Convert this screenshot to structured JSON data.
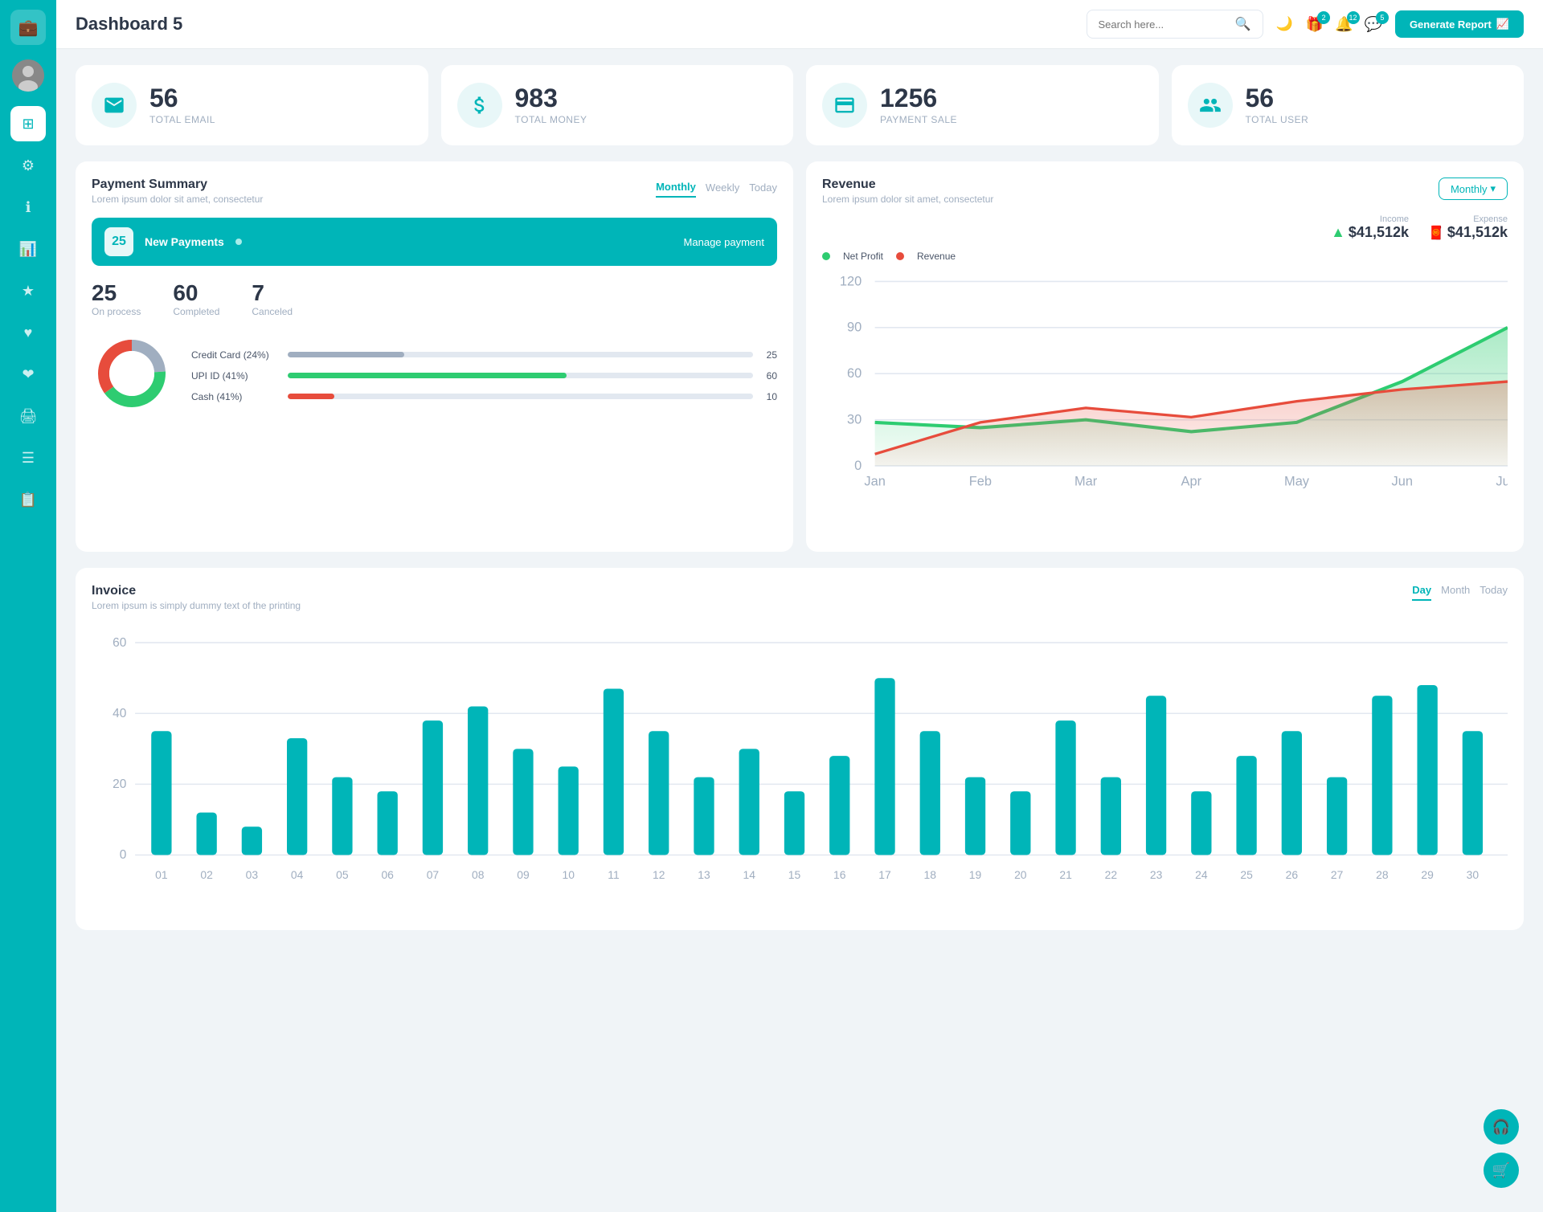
{
  "sidebar": {
    "logo_icon": "💼",
    "items": [
      {
        "id": "dashboard",
        "icon": "⊞",
        "active": true
      },
      {
        "id": "settings",
        "icon": "⚙"
      },
      {
        "id": "info",
        "icon": "ℹ"
      },
      {
        "id": "analytics",
        "icon": "📊"
      },
      {
        "id": "star",
        "icon": "★"
      },
      {
        "id": "heart",
        "icon": "♥"
      },
      {
        "id": "heart2",
        "icon": "❤"
      },
      {
        "id": "print",
        "icon": "🖨"
      },
      {
        "id": "menu",
        "icon": "☰"
      },
      {
        "id": "list",
        "icon": "📋"
      }
    ]
  },
  "header": {
    "title": "Dashboard 5",
    "search_placeholder": "Search here...",
    "badge_gift": "2",
    "badge_bell": "12",
    "badge_chat": "5",
    "generate_btn": "Generate Report"
  },
  "stats": [
    {
      "id": "total-email",
      "icon": "📧",
      "number": "56",
      "label": "TOTAL EMAIL"
    },
    {
      "id": "total-money",
      "icon": "$",
      "number": "983",
      "label": "TOTAL MONEY"
    },
    {
      "id": "payment-sale",
      "icon": "💳",
      "number": "1256",
      "label": "PAYMENT SALE"
    },
    {
      "id": "total-user",
      "icon": "👥",
      "number": "56",
      "label": "TOTAL USER"
    }
  ],
  "payment_summary": {
    "title": "Payment Summary",
    "subtitle": "Lorem ipsum dolor sit amet, consectetur",
    "tabs": [
      "Monthly",
      "Weekly",
      "Today"
    ],
    "active_tab": "Monthly",
    "new_payments_count": "25",
    "new_payments_label": "New Payments",
    "manage_link": "Manage payment",
    "on_process": "25",
    "on_process_label": "On process",
    "completed": "60",
    "completed_label": "Completed",
    "canceled": "7",
    "canceled_label": "Canceled",
    "progress_items": [
      {
        "label": "Credit Card (24%)",
        "value": 25,
        "color": "#a0aec0",
        "display": "25"
      },
      {
        "label": "UPI ID (41%)",
        "value": 60,
        "color": "#2ecc71",
        "display": "60"
      },
      {
        "label": "Cash (41%)",
        "value": 10,
        "color": "#e74c3c",
        "display": "10"
      }
    ],
    "donut": {
      "segments": [
        {
          "color": "#a0aec0",
          "pct": 24
        },
        {
          "color": "#2ecc71",
          "pct": 41
        },
        {
          "color": "#e74c3c",
          "pct": 35
        }
      ]
    }
  },
  "revenue": {
    "title": "Revenue",
    "subtitle": "Lorem ipsum dolor sit amet, consectetur",
    "tab": "Monthly",
    "income_label": "Income",
    "income_value": "$41,512k",
    "expense_label": "Expense",
    "expense_value": "$41,512k",
    "legend": [
      {
        "label": "Net Profit",
        "color": "#2ecc71"
      },
      {
        "label": "Revenue",
        "color": "#e74c3c"
      }
    ],
    "x_labels": [
      "Jan",
      "Feb",
      "Mar",
      "Apr",
      "May",
      "Jun",
      "July"
    ],
    "y_labels": [
      "0",
      "30",
      "60",
      "90",
      "120"
    ],
    "net_profit_points": [
      28,
      25,
      30,
      22,
      28,
      55,
      90
    ],
    "revenue_points": [
      8,
      28,
      38,
      32,
      42,
      50,
      55
    ]
  },
  "invoice": {
    "title": "Invoice",
    "subtitle": "Lorem ipsum is simply dummy text of the printing",
    "tabs": [
      "Day",
      "Month",
      "Today"
    ],
    "active_tab": "Day",
    "y_labels": [
      "0",
      "20",
      "40",
      "60"
    ],
    "x_labels": [
      "01",
      "02",
      "03",
      "04",
      "05",
      "06",
      "07",
      "08",
      "09",
      "10",
      "11",
      "12",
      "13",
      "14",
      "15",
      "16",
      "17",
      "18",
      "19",
      "20",
      "21",
      "22",
      "23",
      "24",
      "25",
      "26",
      "27",
      "28",
      "29",
      "30"
    ],
    "bar_data": [
      35,
      12,
      8,
      33,
      22,
      18,
      38,
      42,
      30,
      25,
      47,
      35,
      22,
      30,
      18,
      28,
      50,
      35,
      22,
      18,
      38,
      22,
      45,
      18,
      28,
      35,
      22,
      45,
      48,
      35
    ]
  },
  "colors": {
    "primary": "#00b5b8",
    "accent": "#2ecc71",
    "danger": "#e74c3c",
    "text_dark": "#2d3748",
    "text_muted": "#a0aec0"
  }
}
